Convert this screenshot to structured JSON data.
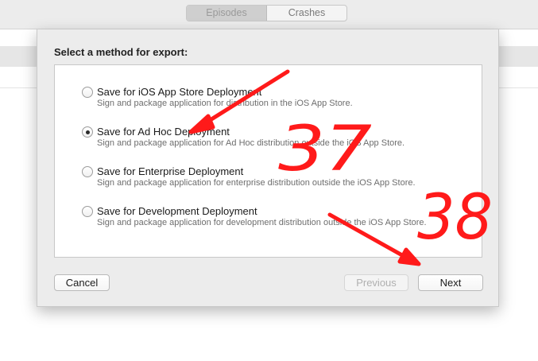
{
  "toolbar": {
    "segments": [
      "Episodes",
      "Crashes"
    ]
  },
  "sheet": {
    "title": "Select a method for export:",
    "options": [
      {
        "label": "Save for iOS App Store Deployment",
        "description": "Sign and package application for distribution in the iOS App Store.",
        "selected": false
      },
      {
        "label": "Save for Ad Hoc Deployment",
        "description": "Sign and package application for Ad Hoc distribution outside the iOS App Store.",
        "selected": true
      },
      {
        "label": "Save for Enterprise Deployment",
        "description": "Sign and package application for enterprise distribution outside the iOS App Store.",
        "selected": false
      },
      {
        "label": "Save for Development Deployment",
        "description": "Sign and package application for development distribution outside the iOS App Store.",
        "selected": false
      }
    ],
    "buttons": {
      "cancel": "Cancel",
      "previous": "Previous",
      "next": "Next"
    }
  },
  "annotations": {
    "numbers": [
      "37",
      "38"
    ],
    "color": "#ff1a1a"
  }
}
